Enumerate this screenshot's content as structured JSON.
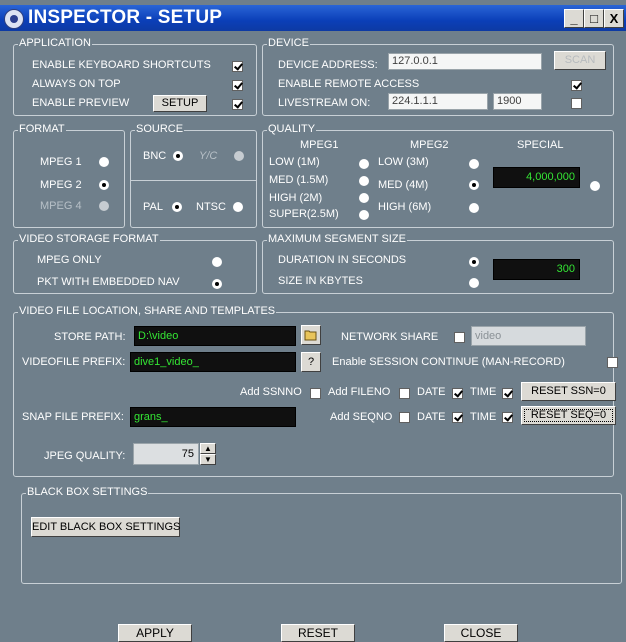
{
  "window": {
    "title": "INSPECTOR - SETUP",
    "minimize": "_",
    "maximize": "□",
    "close": "X"
  },
  "application": {
    "label": "APPLICATION",
    "keyboard_shortcuts": "ENABLE KEYBOARD SHORTCUTS",
    "always_on_top": "ALWAYS ON TOP",
    "enable_preview": "ENABLE PREVIEW",
    "setup_button": "SETUP"
  },
  "device": {
    "label": "DEVICE",
    "address_label": "DEVICE ADDRESS:",
    "address_value": "127.0.0.1",
    "scan_button": "SCAN",
    "remote_access": "ENABLE REMOTE ACCESS",
    "livestream_label": "LIVESTREAM ON:",
    "livestream_ip": "224.1.1.1",
    "livestream_port": "1900"
  },
  "format": {
    "label": "FORMAT",
    "mpeg1": "MPEG 1",
    "mpeg2": "MPEG 2",
    "mpeg4": "MPEG 4"
  },
  "source": {
    "label": "SOURCE",
    "bnc": "BNC",
    "yc": "Y/C",
    "pal": "PAL",
    "ntsc": "NTSC"
  },
  "quality": {
    "label": "QUALITY",
    "mpeg1_header": "MPEG1",
    "mpeg2_header": "MPEG2",
    "special_header": "SPECIAL",
    "low_1m": "LOW (1M)",
    "med_15m": "MED (1.5M)",
    "high_2m": "HIGH (2M)",
    "super_25m": "SUPER(2.5M)",
    "low_3m": "LOW (3M)",
    "med_4m": "MED (4M)",
    "high_6m": "HIGH (6M)",
    "special_value": "4,000,000"
  },
  "storage": {
    "label": "VIDEO STORAGE FORMAT",
    "mpeg_only": "MPEG ONLY",
    "pkt_nav": "PKT WITH EMBEDDED NAV"
  },
  "segment": {
    "label": "MAXIMUM SEGMENT SIZE",
    "duration": "DURATION IN SECONDS",
    "size": "SIZE IN KBYTES",
    "value": "300"
  },
  "files": {
    "label": "VIDEO FILE LOCATION, SHARE AND TEMPLATES",
    "store_path_label": "STORE PATH:",
    "store_path_value": "D:\\video",
    "network_share": "NETWORK SHARE",
    "network_share_value": "video",
    "prefix_label": "VIDEOFILE PREFIX:",
    "prefix_value": "dive1_video_",
    "help_button": "?",
    "session_continue": "Enable SESSION CONTINUE (MAN-RECORD)",
    "add_ssnno": "Add SSNNO",
    "add_fileno": "Add FILENO",
    "date1": "DATE",
    "time1": "TIME",
    "reset_ssn": "RESET SSN=0",
    "snap_label": "SNAP FILE PREFIX:",
    "snap_value": "grans_",
    "add_seqno": "Add SEQNO",
    "date2": "DATE",
    "time2": "TIME",
    "reset_seq": "RESET SEQ=0",
    "jpeg_label": "JPEG QUALITY:",
    "jpeg_value": "75"
  },
  "blackbox": {
    "label": "BLACK BOX SETTINGS",
    "edit_button": "EDIT BLACK BOX SETTINGS"
  },
  "footer": {
    "apply": "APPLY",
    "reset": "RESET",
    "close": "CLOSE"
  }
}
